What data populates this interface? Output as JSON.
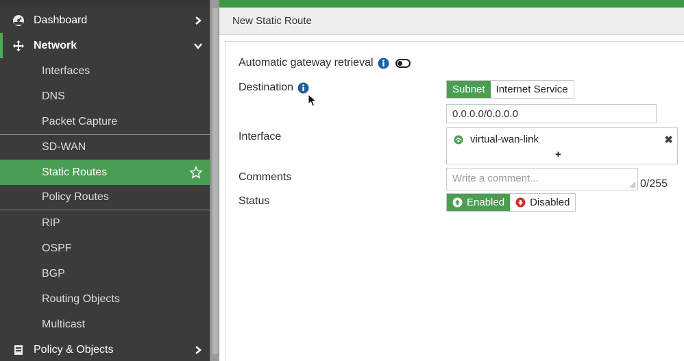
{
  "sidebar": {
    "dashboard": {
      "label": "Dashboard",
      "icon": "dashboard-icon"
    },
    "network": {
      "label": "Network",
      "icon": "network-icon"
    },
    "network_items": [
      "Interfaces",
      "DNS",
      "Packet Capture",
      "SD-WAN",
      "Static Routes",
      "Policy Routes",
      "RIP",
      "OSPF",
      "BGP",
      "Routing Objects",
      "Multicast"
    ],
    "active_item": "Static Routes",
    "policy_objects": {
      "label": "Policy & Objects",
      "icon": "policy-objects-icon"
    }
  },
  "header": {
    "title": "New Static Route"
  },
  "form": {
    "auto_gateway": {
      "label": "Automatic gateway retrieval",
      "enabled": false
    },
    "destination": {
      "label": "Destination",
      "options": [
        "Subnet",
        "Internet Service"
      ],
      "selected": "Subnet",
      "value": "0.0.0.0/0.0.0.0"
    },
    "interface": {
      "label": "Interface",
      "value": "virtual-wan-link",
      "add": "+",
      "remove": "✖"
    },
    "comments": {
      "label": "Comments",
      "placeholder": "Write a comment...",
      "counter": "0/255"
    },
    "status": {
      "label": "Status",
      "enabled_label": "Enabled",
      "disabled_label": "Disabled",
      "selected": "Enabled"
    }
  },
  "colors": {
    "accent": "#4a9e53",
    "sidebar_bg": "#3a3b3a",
    "danger": "#d32f2f",
    "info": "#1f5f9a"
  }
}
